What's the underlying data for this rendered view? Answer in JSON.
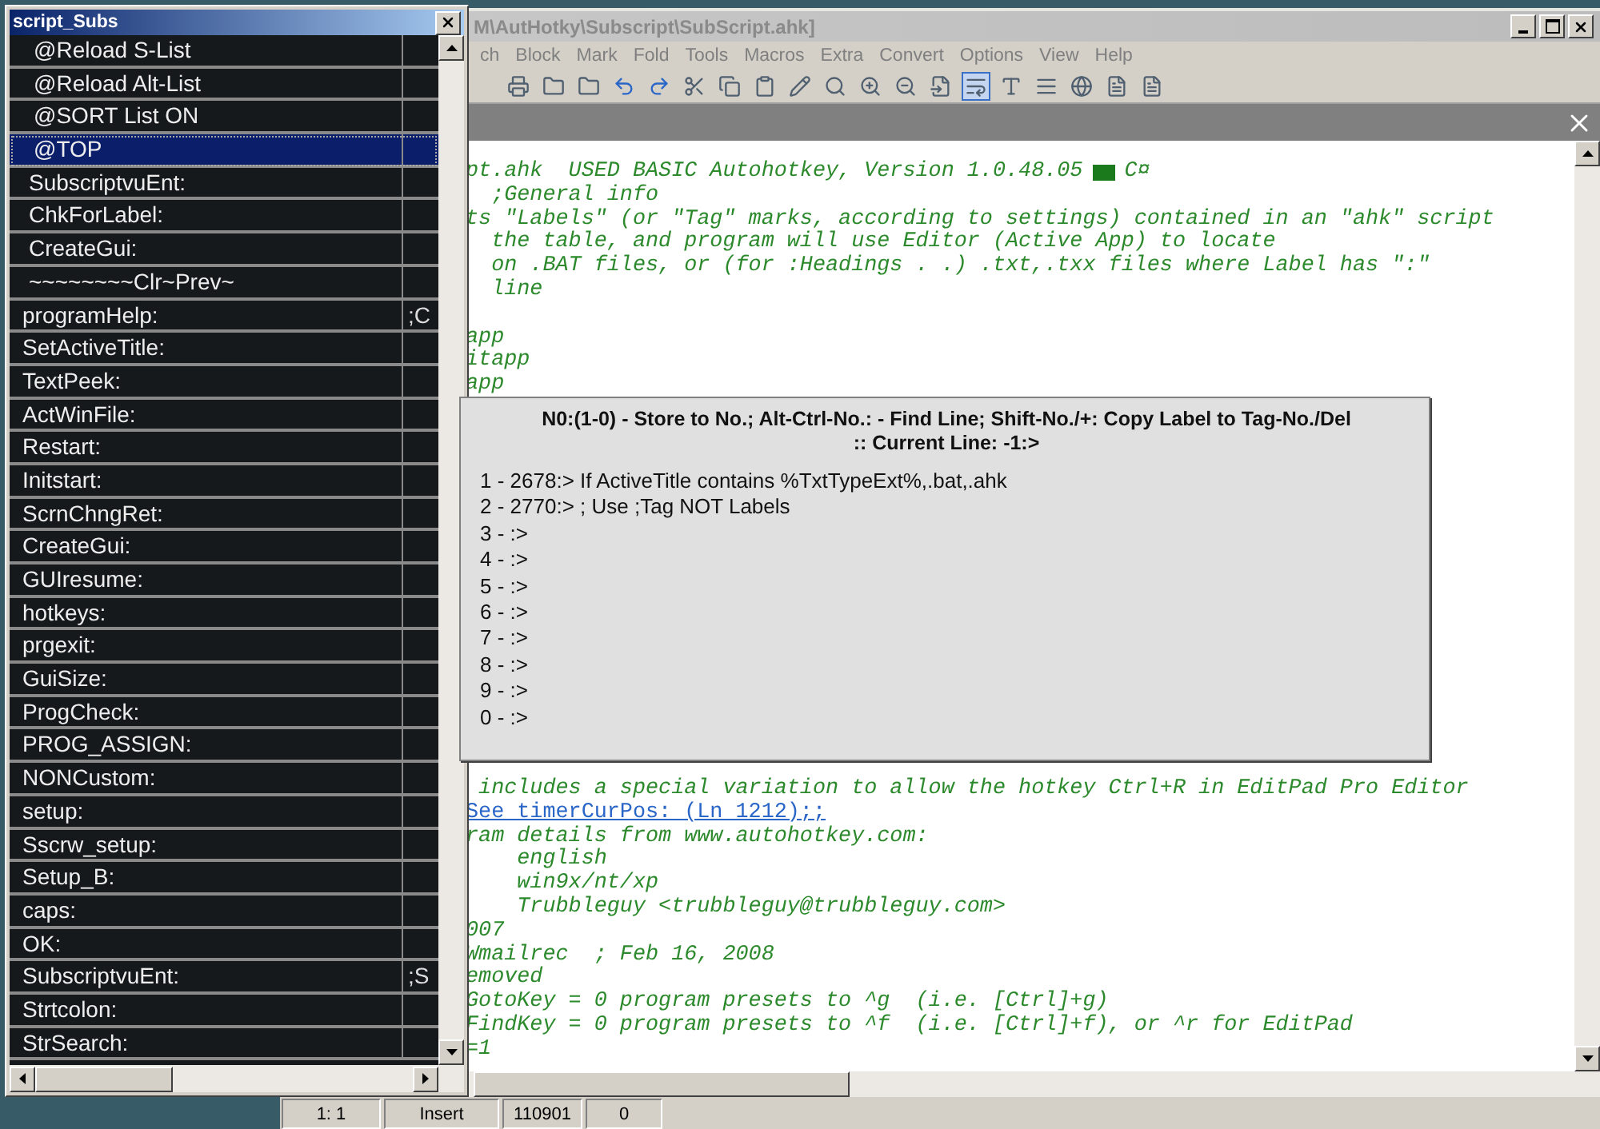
{
  "editor_window": {
    "title": "M\\AutHotky\\Subscript\\SubScript.ahk]",
    "menu": [
      "ch",
      "Block",
      "Mark",
      "Fold",
      "Tools",
      "Macros",
      "Extra",
      "Convert",
      "Options",
      "View",
      "Help"
    ],
    "lines_top": [
      {
        "kind": "version",
        "text": "pt.ahk  USED BASIC Autohotkey, Version 1.0.48.05",
        "suffix": "C¤"
      },
      {
        "kind": "code",
        "text": "  ;General info"
      },
      {
        "kind": "code",
        "text": "ts \"Labels\" (or \"Tag\" marks, according to settings) contained in an \"ahk\" script"
      },
      {
        "kind": "code",
        "text": "  the table, and program will use Editor (Active App) to locate"
      },
      {
        "kind": "code",
        "text": "  on .BAT files, or (for :Headings . .) .txt,.txx files where Label has \":\""
      },
      {
        "kind": "code",
        "text": "  line"
      },
      {
        "kind": "blank"
      },
      {
        "kind": "code",
        "text": "app"
      },
      {
        "kind": "code",
        "text": "itapp"
      },
      {
        "kind": "code",
        "text": "app"
      }
    ],
    "lines_bottom": [
      {
        "kind": "code",
        "text": " includes a special variation to allow the hotkey Ctrl+R in EditPad Pro Editor"
      },
      {
        "kind": "link",
        "text": " See timerCurPos: (Ln 1212);;"
      },
      {
        "kind": "code",
        "text": "ram details from www.autohotkey.com:"
      },
      {
        "kind": "code",
        "text": "    english"
      },
      {
        "kind": "code",
        "text": "    win9x/nt/xp"
      },
      {
        "kind": "code",
        "text": "    Trubbleguy <trubbleguy@trubbleguy.com>"
      },
      {
        "kind": "code",
        "text": "007"
      },
      {
        "kind": "code",
        "text": "Wmailrec  ; Feb 16, 2008"
      },
      {
        "kind": "code",
        "text": "emoved"
      },
      {
        "kind": "code",
        "text": "GotoKey = 0 program presets to ^g  (i.e. [Ctrl]+g)"
      },
      {
        "kind": "code",
        "text": "FindKey = 0 program presets to ^f  (i.e. [Ctrl]+f), or ^r for EditPad"
      },
      {
        "kind": "code",
        "text": "=1"
      }
    ],
    "status_bar": [
      "1: 1",
      "Insert",
      "110901",
      "0"
    ]
  },
  "subs_window": {
    "title": "script_Subs",
    "rows": [
      {
        "kind": "command",
        "label": "@Reload S-List",
        "selected": false
      },
      {
        "kind": "command",
        "label": "@Reload Alt-List",
        "selected": false
      },
      {
        "kind": "command",
        "label": "@SORT List ON",
        "selected": false
      },
      {
        "kind": "command",
        "label": "@TOP",
        "selected": true
      },
      {
        "kind": "pinned",
        "label": "SubscriptvuEnt:",
        "selected": false
      },
      {
        "kind": "pinned",
        "label": "ChkForLabel:",
        "selected": false
      },
      {
        "kind": "pinned",
        "label": "CreateGui:",
        "selected": false
      },
      {
        "kind": "pinned",
        "label": "~~~~~~~~Clr~Prev~",
        "selected": false
      },
      {
        "kind": "label",
        "label": "programHelp:",
        "column_2": ";C",
        "selected": false
      },
      {
        "kind": "label",
        "label": "SetActiveTitle:",
        "selected": false
      },
      {
        "kind": "label",
        "label": "TextPeek:",
        "selected": false
      },
      {
        "kind": "label",
        "label": "ActWinFile:",
        "selected": false
      },
      {
        "kind": "label",
        "label": "Restart:",
        "selected": false
      },
      {
        "kind": "label",
        "label": "Initstart:",
        "selected": false
      },
      {
        "kind": "label",
        "label": "ScrnChngRet:",
        "selected": false
      },
      {
        "kind": "label",
        "label": "CreateGui:",
        "selected": false
      },
      {
        "kind": "label",
        "label": "GUIresume:",
        "selected": false
      },
      {
        "kind": "label",
        "label": "hotkeys:",
        "selected": false
      },
      {
        "kind": "label",
        "label": "prgexit:",
        "selected": false
      },
      {
        "kind": "label",
        "label": "GuiSize:",
        "selected": false
      },
      {
        "kind": "label",
        "label": "ProgCheck:",
        "selected": false
      },
      {
        "kind": "label",
        "label": "PROG_ASSIGN:",
        "selected": false
      },
      {
        "kind": "label",
        "label": "NONCustom:",
        "selected": false
      },
      {
        "kind": "label",
        "label": "setup:",
        "selected": false
      },
      {
        "kind": "label",
        "label": "Sscrw_setup:",
        "selected": false
      },
      {
        "kind": "label",
        "label": "Setup_B:",
        "selected": false
      },
      {
        "kind": "label",
        "label": "caps:",
        "selected": false
      },
      {
        "kind": "label",
        "label": "OK:",
        "selected": false
      },
      {
        "kind": "label",
        "label": "SubscriptvuEnt:",
        "column_2": ";S",
        "selected": false
      },
      {
        "kind": "label",
        "label": "Strtcolon:",
        "selected": false
      },
      {
        "kind": "label",
        "label": "StrSearch:",
        "selected": false
      }
    ]
  },
  "tag_popup": {
    "header": [
      "N0:(1-0) - Store to No.;  Alt-Ctrl-No.: - Find Line;  Shift-No./+:  Copy Label to Tag-No./Del",
      ":: Current Line: -1:>"
    ],
    "slots": [
      "1 - 2678:> If ActiveTitle contains %TxtTypeExt%,.bat,.ahk",
      "2 - 2770:> ; Use ;Tag NOT Labels",
      "3 - :>",
      "4 - :>",
      "5 - :>",
      "6 - :>",
      "7 - :>",
      "8 - :>",
      "9 - :>",
      "0 - :>"
    ]
  }
}
